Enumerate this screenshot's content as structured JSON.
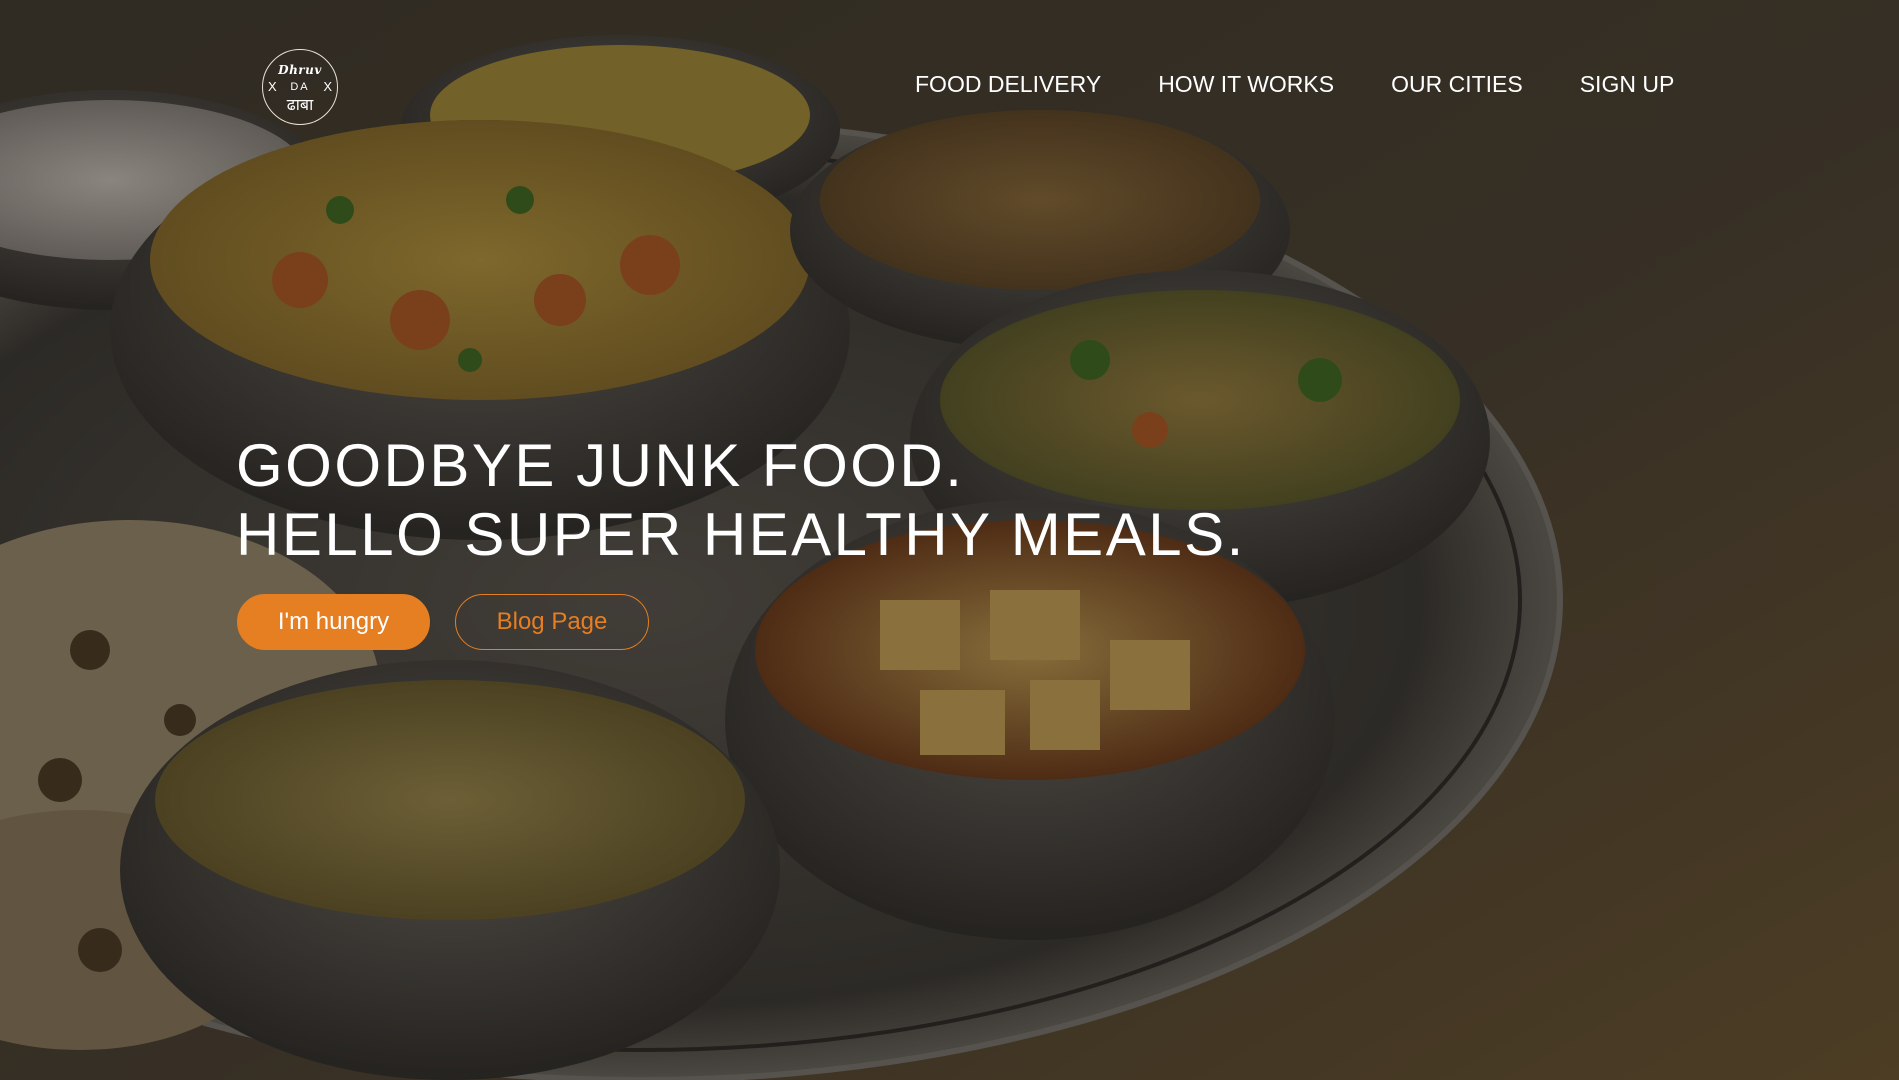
{
  "colors": {
    "accent": "#e67e22",
    "text": "#ffffff",
    "background_tone": "#4a4034"
  },
  "logo": {
    "line1": "Dhruv",
    "line2": "DA",
    "line3": "ढाबा",
    "cross_left": "X",
    "cross_right": "X"
  },
  "nav": {
    "items": [
      {
        "label": "FOOD DELIVERY"
      },
      {
        "label": "HOW IT WORKS"
      },
      {
        "label": "OUR CITIES"
      },
      {
        "label": "SIGN UP"
      }
    ]
  },
  "hero": {
    "headline_line1": "GOODBYE JUNK FOOD.",
    "headline_line2": "HELLO SUPER HEALTHY MEALS.",
    "primary_button": "I'm hungry",
    "secondary_button": "Blog Page",
    "background_image": "thali-plate-photo"
  }
}
